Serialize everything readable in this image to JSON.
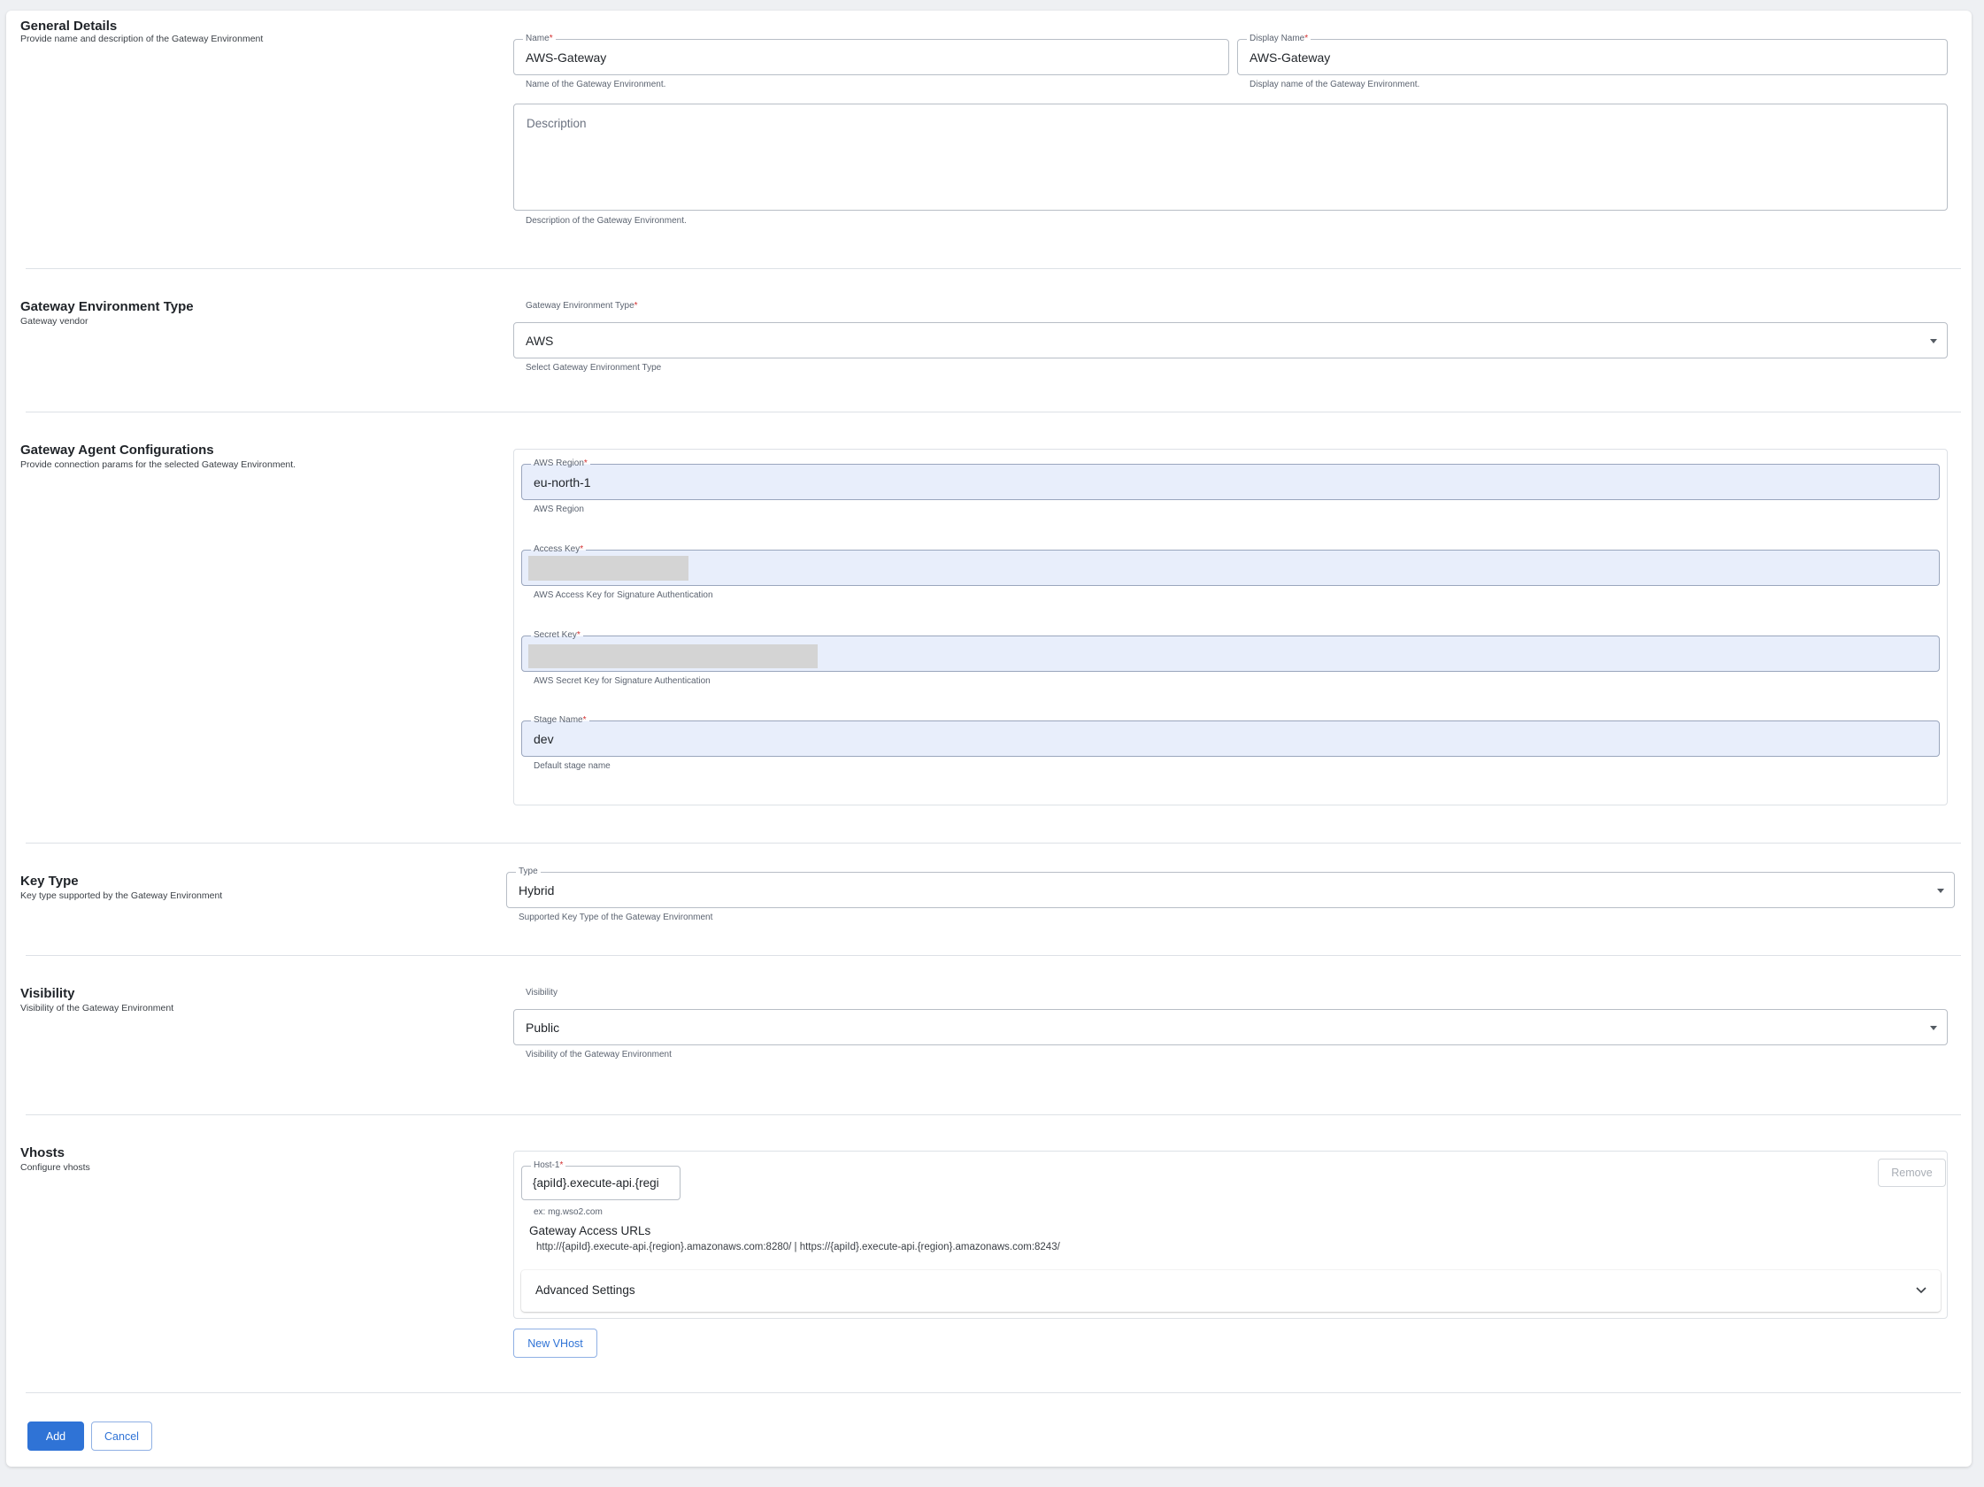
{
  "general": {
    "title": "General Details",
    "desc": "Provide name and description of the Gateway Environment",
    "name_label": "Name",
    "name_value": "AWS-Gateway",
    "name_help": "Name of the Gateway Environment.",
    "display_name_label": "Display Name",
    "display_name_value": "AWS-Gateway",
    "display_name_help": "Display name of the Gateway Environment.",
    "description_placeholder": "Description",
    "description_help": "Description of the Gateway Environment."
  },
  "env_type": {
    "title": "Gateway Environment Type",
    "desc": "Gateway vendor",
    "label": "Gateway Environment Type",
    "value": "AWS",
    "help": "Select Gateway Environment Type"
  },
  "agent": {
    "title": "Gateway Agent Configurations",
    "desc": "Provide connection params for the selected Gateway Environment.",
    "region_label": "AWS Region",
    "region_value": "eu-north-1",
    "region_help": "AWS Region",
    "access_key_label": "Access Key",
    "access_key_help": "AWS Access Key for Signature Authentication",
    "secret_key_label": "Secret Key",
    "secret_key_help": "AWS Secret Key for Signature Authentication",
    "stage_label": "Stage Name",
    "stage_value": "dev",
    "stage_help": "Default stage name"
  },
  "key_type": {
    "title": "Key Type",
    "desc": "Key type supported by the Gateway Environment",
    "label": "Type",
    "value": "Hybrid",
    "help": "Supported Key Type of the Gateway Environment"
  },
  "visibility": {
    "title": "Visibility",
    "desc": "Visibility of the Gateway Environment",
    "label": "Visibility",
    "value": "Public",
    "help": "Visibility of the Gateway Environment"
  },
  "vhosts": {
    "title": "Vhosts",
    "desc": "Configure vhosts",
    "host_label": "Host-1",
    "host_value": "{apiId}.execute-api.{regi",
    "host_help": "ex: mg.wso2.com",
    "remove_label": "Remove",
    "access_urls_title": "Gateway Access URLs",
    "access_urls": "http://{apiId}.execute-api.{region}.amazonaws.com:8280/ | https://{apiId}.execute-api.{region}.amazonaws.com:8243/",
    "advanced_label": "Advanced Settings",
    "new_vhost_label": "New VHost"
  },
  "actions": {
    "add_label": "Add",
    "cancel_label": "Cancel"
  },
  "required_mark": "*",
  "colors": {
    "accent": "#2f73d6",
    "required": "#d32f2f",
    "filled_field": "#e8eefb"
  },
  "icons": {
    "select_caret": "caret-down-icon",
    "accordion": "chevron-down-icon"
  }
}
